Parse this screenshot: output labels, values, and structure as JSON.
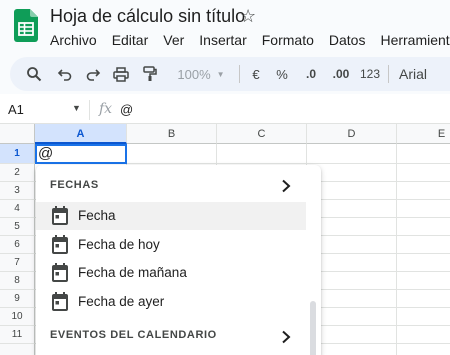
{
  "app": {
    "doc_title": "Hoja de cálculo sin título",
    "brand_color": "#0f9d58"
  },
  "menu": [
    "Archivo",
    "Editar",
    "Ver",
    "Insertar",
    "Formato",
    "Datos",
    "Herramientas"
  ],
  "toolbar": {
    "icons": [
      "search-icon",
      "undo-icon",
      "redo-icon",
      "print-icon",
      "paint-format-icon"
    ],
    "zoom": "100%",
    "currency": "€",
    "percent": "%",
    "decrease_decimals": ".0",
    "increase_decimals": ".00",
    "number_format": "123",
    "font": "Arial"
  },
  "formula_bar": {
    "name_box": "A1",
    "fx": "fx",
    "value": "@"
  },
  "grid": {
    "columns": [
      "A",
      "B",
      "C",
      "D",
      "E"
    ],
    "rows": [
      "1",
      "2",
      "3",
      "4",
      "5",
      "6",
      "7",
      "8",
      "9",
      "10",
      "11"
    ],
    "active_cell_value": "@",
    "selection_color": "#1a73e8"
  },
  "dropdown": {
    "section_dates": "FECHAS",
    "items": [
      "Fecha",
      "Fecha de hoy",
      "Fecha de mañana",
      "Fecha de ayer"
    ],
    "section_calendar": "EVENTOS DEL CALENDARIO"
  }
}
